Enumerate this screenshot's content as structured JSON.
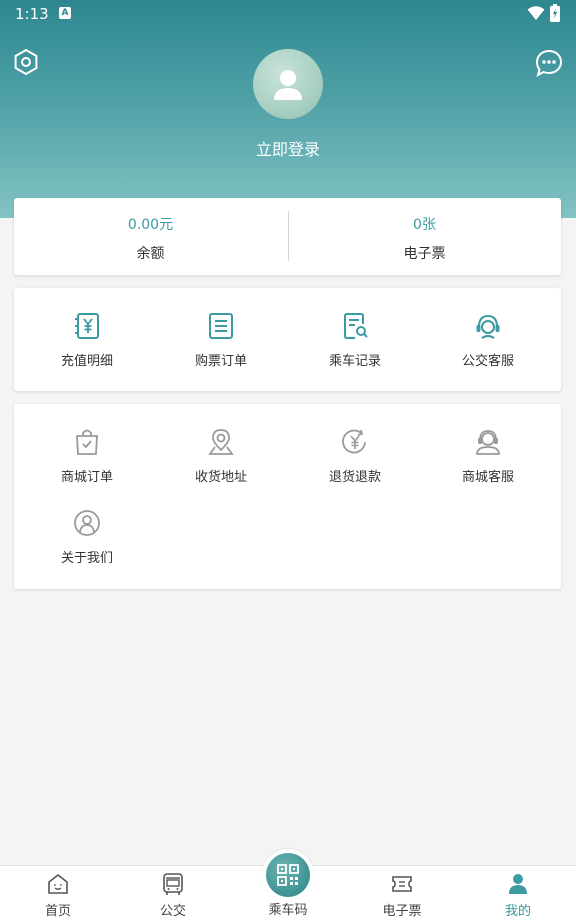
{
  "status_bar": {
    "time": "1:13",
    "notif_glyph": "A"
  },
  "profile": {
    "login_text": "立即登录"
  },
  "balance": {
    "balance_value": "0.00元",
    "balance_label": "余额",
    "eticket_value": "0张",
    "eticket_label": "电子票"
  },
  "menu1": [
    {
      "label": "充值明细",
      "icon": "recharge-detail-icon"
    },
    {
      "label": "购票订单",
      "icon": "ticket-order-icon"
    },
    {
      "label": "乘车记录",
      "icon": "ride-record-icon"
    },
    {
      "label": "公交客服",
      "icon": "bus-service-icon"
    }
  ],
  "menu2": [
    {
      "label": "商城订单",
      "icon": "shop-order-icon"
    },
    {
      "label": "收货地址",
      "icon": "address-icon"
    },
    {
      "label": "退货退款",
      "icon": "refund-icon"
    },
    {
      "label": "商城客服",
      "icon": "shop-service-icon"
    },
    {
      "label": "关于我们",
      "icon": "about-icon"
    }
  ],
  "bottom_nav": [
    {
      "label": "首页",
      "icon": "home-icon"
    },
    {
      "label": "公交",
      "icon": "bus-icon"
    },
    {
      "label": "乘车码",
      "icon": "qr-code-icon"
    },
    {
      "label": "电子票",
      "icon": "eticket-icon"
    },
    {
      "label": "我的",
      "icon": "user-icon",
      "active": true
    }
  ],
  "colors": {
    "accent": "#3b9aa2",
    "header_top": "#2e8790",
    "header_bottom": "#83c3c3"
  }
}
